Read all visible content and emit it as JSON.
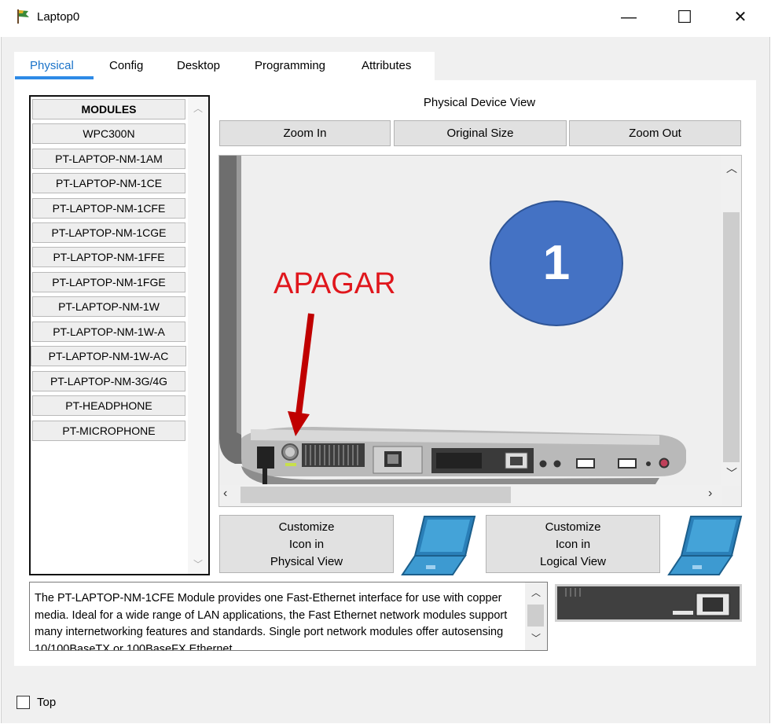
{
  "window": {
    "title": "Laptop0",
    "minimize": "—",
    "maximize": "☐",
    "close": "✕"
  },
  "tabs": [
    {
      "label": "Physical",
      "active": true
    },
    {
      "label": "Config",
      "active": false
    },
    {
      "label": "Desktop",
      "active": false
    },
    {
      "label": "Programming",
      "active": false
    },
    {
      "label": "Attributes",
      "active": false
    }
  ],
  "modules": {
    "header": "MODULES",
    "items": [
      "WPC300N",
      "PT-LAPTOP-NM-1AM",
      "PT-LAPTOP-NM-1CE",
      "PT-LAPTOP-NM-1CFE",
      "PT-LAPTOP-NM-1CGE",
      "PT-LAPTOP-NM-1FFE",
      "PT-LAPTOP-NM-1FGE",
      "PT-LAPTOP-NM-1W",
      "PT-LAPTOP-NM-1W-A",
      "PT-LAPTOP-NM-1W-AC",
      "PT-LAPTOP-NM-3G/4G",
      "PT-HEADPHONE",
      "PT-MICROPHONE"
    ]
  },
  "physical_view": {
    "title": "Physical Device View",
    "zoom_in": "Zoom In",
    "original_size": "Original Size",
    "zoom_out": "Zoom Out"
  },
  "annotation": {
    "label": "APAGAR",
    "badge_number": "1",
    "label_color": "#e0161c",
    "badge_color": "#4472c4"
  },
  "customize": {
    "physical": [
      "Customize",
      "Icon in",
      "Physical View"
    ],
    "logical": [
      "Customize",
      "Icon in",
      "Logical View"
    ]
  },
  "description": "The PT-LAPTOP-NM-1CFE Module provides one Fast-Ethernet interface for use with copper media. Ideal for a wide range of LAN applications, the Fast Ethernet network modules support many internetworking features and standards. Single port network modules offer autosensing 10/100BaseTX or 100BaseFX Ethernet",
  "footer": {
    "top_label": "Top",
    "top_checked": false
  },
  "colors": {
    "accent": "#2e8ae6",
    "tab_active_text": "#1a73c9",
    "panel_bg": "#f0f0f0"
  }
}
